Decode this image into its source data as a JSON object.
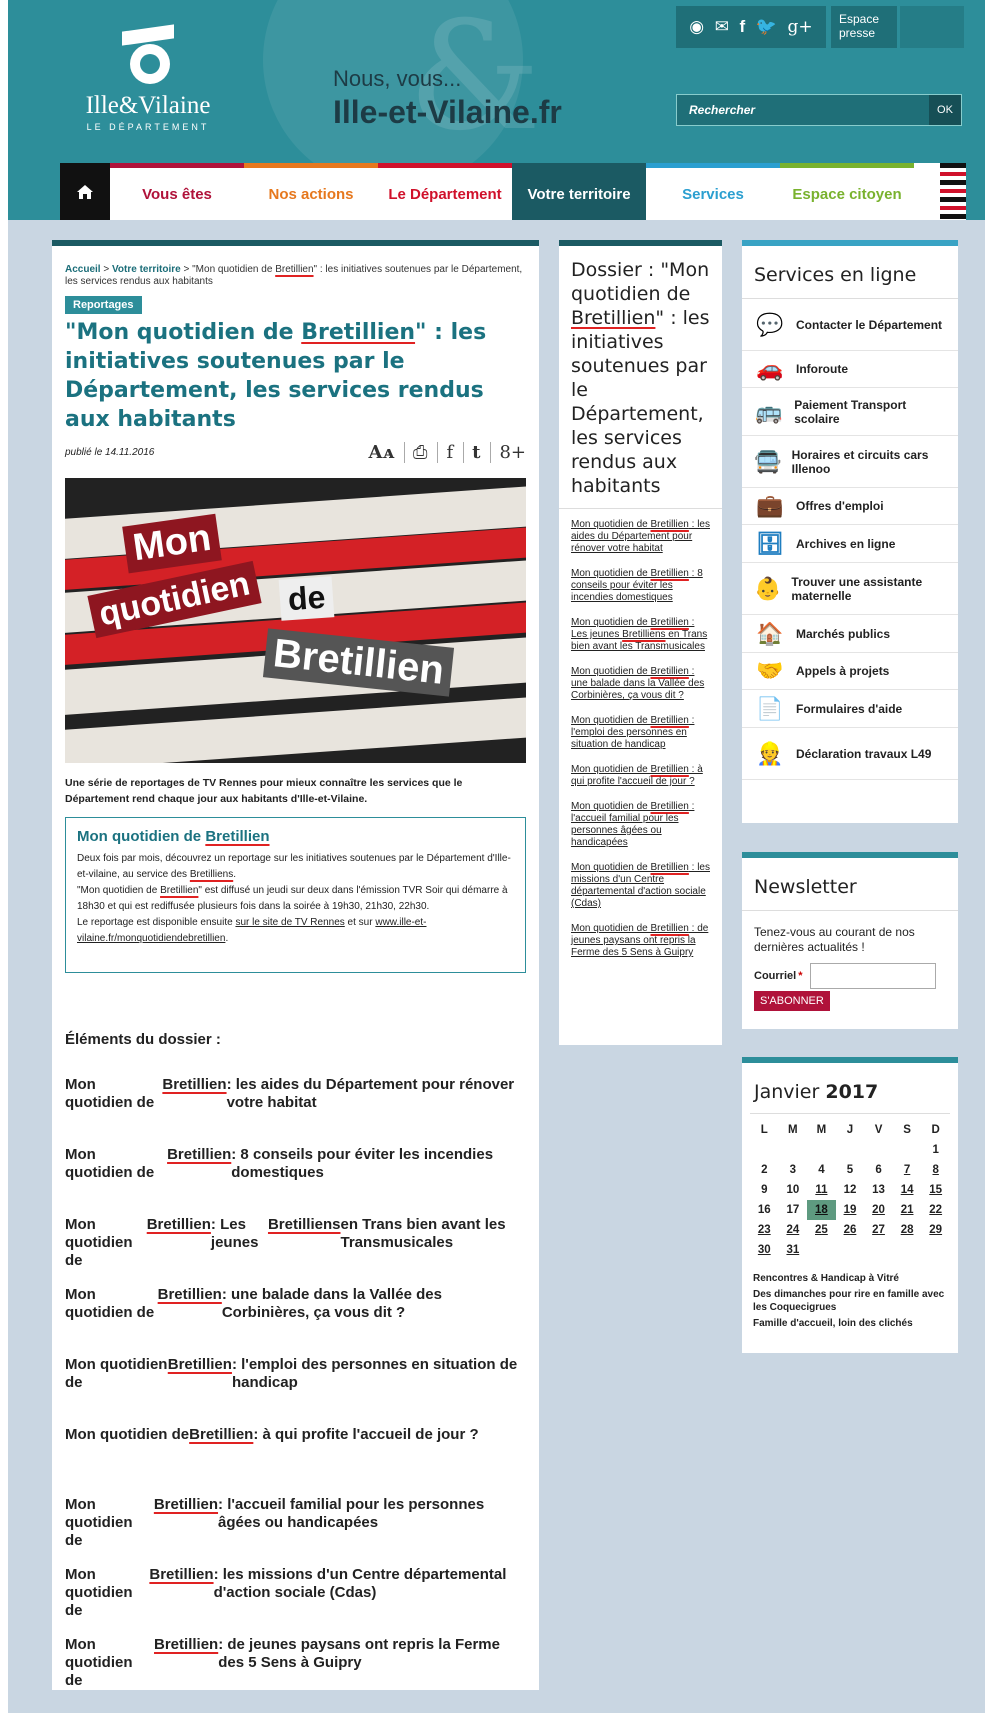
{
  "header": {
    "logo_name": "Ille&Vilaine",
    "logo_sub": "LE DÉPARTEMENT",
    "tagline_line1": "Nous, vous...",
    "tagline_line2": "Ille-et-Vilaine.fr",
    "social_icons": [
      "rss-icon",
      "mail-icon",
      "facebook-icon",
      "twitter-icon",
      "google-plus-icon"
    ],
    "press": "Espace presse",
    "search_placeholder": "Rechercher",
    "search_ok": "OK"
  },
  "nav": {
    "items": [
      {
        "label": "Vous êtes",
        "color": "#b0123a"
      },
      {
        "label": "Nos actions",
        "color": "#e6781e"
      },
      {
        "label": "Le Département",
        "color": "#d0112b"
      },
      {
        "label": "Votre territoire",
        "color": "#ffffff"
      },
      {
        "label": "Services",
        "color": "#2b9fd0"
      },
      {
        "label": "Espace citoyen",
        "color": "#79b22e"
      }
    ]
  },
  "main": {
    "breadcrumb_home": "Accueil",
    "breadcrumb_sep": " > ",
    "breadcrumb_section": "Votre territoire",
    "breadcrumb_current": "\"Mon quotidien de Bretillien\" : les initiatives soutenues par le Département, les services rendus aux habitants",
    "category": "Reportages",
    "title": "\"Mon quotidien de Bretillien\" : les initiatives soutenues par le Département, les services rendus aux habitants",
    "published": "publié le 14.11.2016",
    "share": [
      "Aᴀ",
      "⎙",
      "f",
      "t",
      "8+"
    ],
    "hero_words": [
      "Mon",
      "quotidien",
      "de",
      "Bretillien"
    ],
    "intro": "Une série de reportages de TV Rennes pour mieux connaître les services que le Département rend chaque jour aux habitants d'Ille-et-Vilaine.",
    "box_title": "Mon quotidien de Bretillien",
    "box_p1": "Deux fois par mois, découvrez un reportage sur les initiatives soutenues par le Département d'Ille-et-vilaine, au service des Bretilliens.",
    "box_p2": "\"Mon quotidien de Bretillien\" est diffusé un jeudi sur deux dans l'émission TVR Soir qui démarre à 18h30 et qui est rediffusée plusieurs fois dans la soirée à 19h30, 21h30, 22h30.",
    "box_p3_a": " Le reportage est disponible ensuite ",
    "box_p3_link1": "sur le site de TV Rennes",
    "box_p3_b": " et sur ",
    "box_p3_link2": "www.ille-et-vilaine.fr/monquotidiendebretillien",
    "box_p3_c": ".",
    "elements_head": "Éléments du dossier :",
    "elements": [
      "Mon quotidien de Bretillien : les aides du Département pour rénover votre habitat",
      "Mon quotidien de Bretillien : 8 conseils pour éviter les incendies domestiques",
      "Mon quotidien de Bretillien : Les jeunes Bretilliens en Trans bien avant les Transmusicales",
      "Mon quotidien de Bretillien : une balade dans la Vallée des Corbinières, ça vous dit ?",
      "Mon quotidien de Bretillien : l'emploi des personnes en situation de handicap",
      "Mon quotidien de Bretillien : à qui profite l'accueil de jour ?",
      "Mon quotidien de Bretillien : l'accueil familial pour les personnes âgées ou handicapées",
      "Mon quotidien de Bretillien : les missions d'un Centre départemental d'action sociale (Cdas)",
      "Mon quotidien de Bretillien : de jeunes paysans ont repris la Ferme des 5 Sens à Guipry"
    ]
  },
  "dossier": {
    "title": "Dossier : \"Mon quotidien de Bretillien\" : les initiatives soutenues par le Département, les services rendus aux habitants",
    "links": [
      "Mon quotidien de Bretillien : les aides du Département pour rénover votre habitat",
      "Mon quotidien de Bretillien : 8 conseils pour éviter les incendies domestiques",
      "Mon quotidien de Bretillien : Les jeunes Bretilliens en Trans bien avant les Transmusicales",
      "Mon quotidien de Bretillien : une balade dans la Vallée des Corbinières, ça vous dit ?",
      "Mon quotidien de Bretillien : l'emploi des personnes en situation de handicap",
      "Mon quotidien de Bretillien : à qui profite l'accueil de jour ?",
      "Mon quotidien de Bretillien : l'accueil familial pour les personnes âgées ou handicapées",
      "Mon quotidien de Bretillien : les missions d'un Centre départemental d'action sociale (Cdas)",
      "Mon quotidien de Bretillien : de jeunes paysans ont repris la Ferme des 5 Sens à Guipry"
    ]
  },
  "services": {
    "title": "Services en ligne",
    "items": [
      {
        "label": "Contacter le Département",
        "icon": "chat-icon"
      },
      {
        "label": "Inforoute",
        "icon": "car-icon"
      },
      {
        "label": "Paiement Transport scolaire",
        "icon": "bus-icon"
      },
      {
        "label": "Horaires et circuits cars Illenoo",
        "icon": "coach-icon"
      },
      {
        "label": "Offres d'emploi",
        "icon": "briefcase-icon"
      },
      {
        "label": "Archives en ligne",
        "icon": "archive-icon"
      },
      {
        "label": "Trouver une assistante maternelle",
        "icon": "baby-icon"
      },
      {
        "label": "Marchés publics",
        "icon": "house-icon"
      },
      {
        "label": "Appels à projets",
        "icon": "handshake-icon"
      },
      {
        "label": "Formulaires d'aide",
        "icon": "document-icon"
      },
      {
        "label": "Déclaration travaux L49",
        "icon": "worker-icon"
      }
    ]
  },
  "newsletter": {
    "title": "Newsletter",
    "text": "Tenez-vous au courant de nos dernières actualités !",
    "label": "Courriel",
    "required": "*",
    "button": "S'abonner"
  },
  "calendar": {
    "month": "Janvier",
    "year": "2017",
    "weekdays": [
      "L",
      "M",
      "M",
      "J",
      "V",
      "S",
      "D"
    ],
    "lead_blanks": 6,
    "days": 31,
    "linked_days": [
      7,
      8,
      11,
      14,
      15,
      18,
      19,
      20,
      21,
      22,
      23,
      24,
      25,
      26,
      27,
      28,
      29,
      30,
      31
    ],
    "today": 18,
    "events": [
      "Rencontres & Handicap à Vitré",
      "Des dimanches pour rire en famille avec les Coquecigrues",
      "Famille d'accueil, loin des clichés"
    ]
  },
  "colors": {
    "teal": "#2d8e9a",
    "dark_teal": "#1b5a63",
    "red_underline": "#e02222"
  }
}
